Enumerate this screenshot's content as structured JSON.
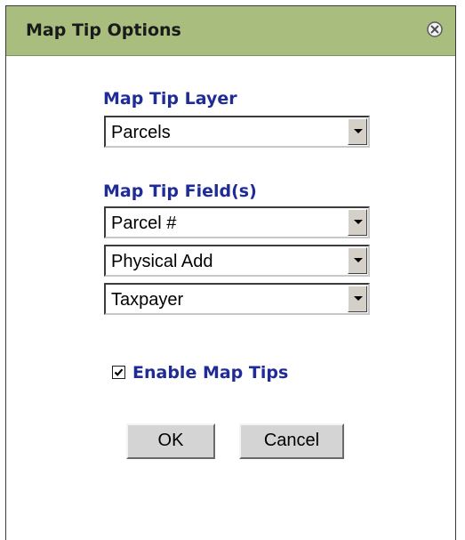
{
  "dialog": {
    "title": "Map Tip Options",
    "close_icon": "close-icon",
    "titlebar_color": "#a8bd7e"
  },
  "layer_section": {
    "label": "Map Tip Layer",
    "selected": "Parcels"
  },
  "fields_section": {
    "label": "Map Tip Field(s)",
    "fields": [
      {
        "selected": "Parcel #"
      },
      {
        "selected": "Physical Add"
      },
      {
        "selected": "Taxpayer"
      }
    ]
  },
  "enable": {
    "label": "Enable Map Tips",
    "checked": true
  },
  "buttons": {
    "ok_label": "OK",
    "cancel_label": "Cancel"
  },
  "colors": {
    "label_blue": "#1f2b97"
  }
}
